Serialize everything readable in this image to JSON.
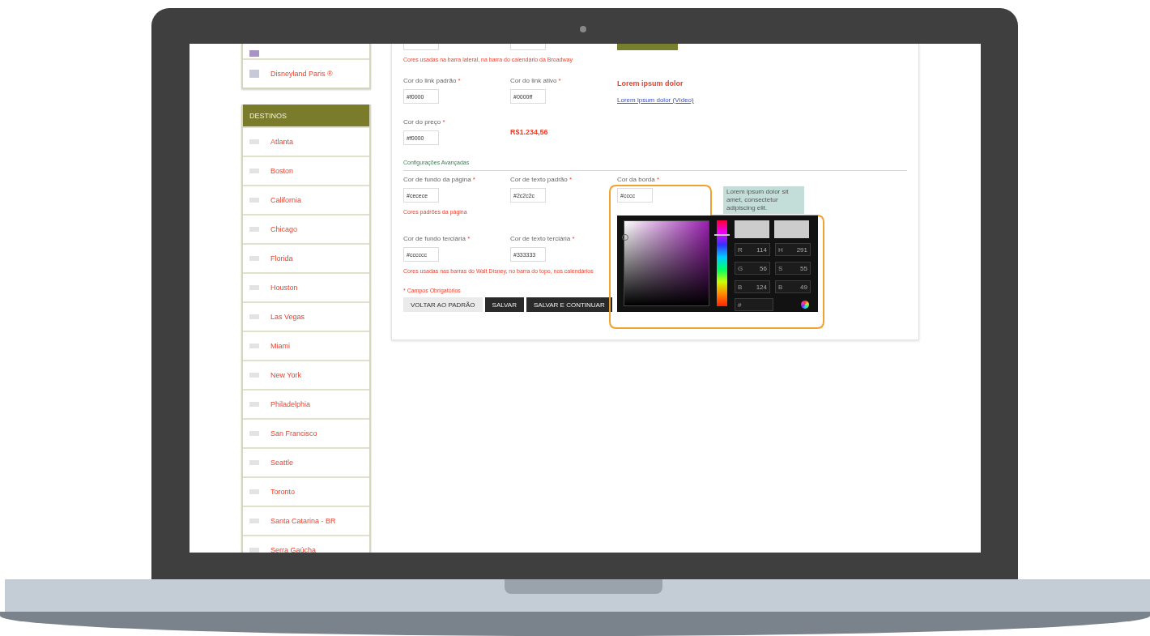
{
  "attractions": [
    {
      "label": "Disneyland Paris ®"
    }
  ],
  "destinations": {
    "title": "DESTINOS",
    "items": [
      {
        "label": "Atlanta"
      },
      {
        "label": "Boston"
      },
      {
        "label": "California"
      },
      {
        "label": "Chicago"
      },
      {
        "label": "Florida"
      },
      {
        "label": "Houston"
      },
      {
        "label": "Las Vegas"
      },
      {
        "label": "Miami"
      },
      {
        "label": "New York"
      },
      {
        "label": "Philadelphia"
      },
      {
        "label": "San Francisco"
      },
      {
        "label": "Seattle"
      },
      {
        "label": "Toronto"
      },
      {
        "label": "Santa Catarina - BR"
      },
      {
        "label": "Serra Gaúcha"
      }
    ]
  },
  "top_note": "Cores usadas na barra lateral, na barra do calendário da Broadway",
  "link_fields": [
    {
      "label": "Cor do link padrão",
      "mark": "*",
      "value": "#f0000"
    },
    {
      "label": "Cor do link ativo",
      "mark": "*",
      "value": "#0000ff"
    }
  ],
  "link_preview": {
    "text": "Lorem ipsum dolor",
    "link": "Lorem ipsum dolor (Vídeo)"
  },
  "price_field": {
    "label": "Cor do preço",
    "mark": "*",
    "value": "#f0000"
  },
  "price_preview": "R$1.234,56",
  "advanced_title": "Configurações Avançadas",
  "page_fields": [
    {
      "label": "Cor de fundo da página",
      "mark": "*",
      "value": "#cecece"
    },
    {
      "label": "Cor de texto padrão",
      "mark": "*",
      "value": "#2c2c2c"
    },
    {
      "label": "Cor da borda",
      "mark": "*",
      "value": "#cccc"
    }
  ],
  "page_note": "Cores padrões da página",
  "tooltip": "Lorem ipsum dolor sit amet, consectetur adipiscing elit.",
  "tertiary_fields": [
    {
      "label": "Cor de fundo terciária",
      "mark": "*",
      "value": "#cccccc"
    },
    {
      "label": "Cor de texto terciária",
      "mark": "*",
      "value": "#333333"
    }
  ],
  "tertiary_note": "Cores usadas nas barras do Walt Disney, no barra do topo, nos calendários",
  "required_note": "* Campos Obrigatórios",
  "buttons": [
    {
      "label": "VOLTAR AO PADRÃO",
      "kind": "secondary"
    },
    {
      "label": "SALVAR",
      "kind": "primary"
    },
    {
      "label": "SALVAR E CONTINUAR",
      "kind": "primary"
    }
  ],
  "color_picker": {
    "hue_slider": {
      "level": 0.83
    },
    "fields": [
      {
        "label": "R",
        "value": "114"
      },
      {
        "label": "H",
        "value": "291"
      },
      {
        "label": "G",
        "value": "56"
      },
      {
        "label": "S",
        "value": "55"
      },
      {
        "label": "B",
        "value": "124"
      },
      {
        "label": "B",
        "value": "49"
      }
    ],
    "hex_label": "#"
  }
}
